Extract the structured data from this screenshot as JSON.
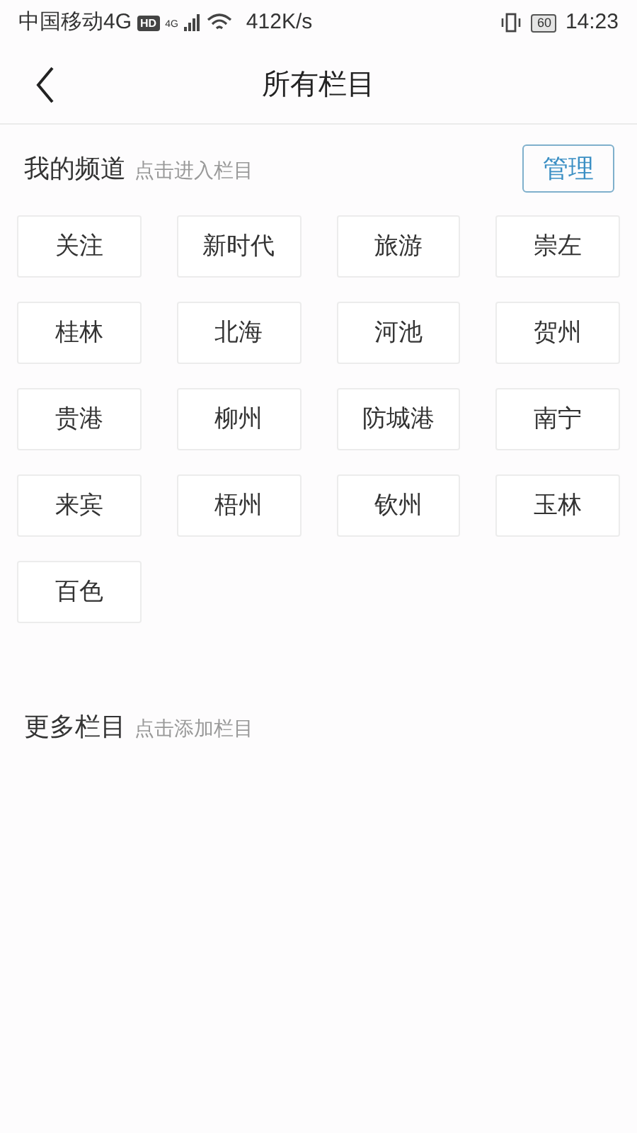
{
  "status_bar": {
    "carrier": "中国移动4G",
    "hd_badge": "HD",
    "network": "4G",
    "speed": "412K/s",
    "battery": "60",
    "time": "14:23"
  },
  "header": {
    "title": "所有栏目"
  },
  "my_channels": {
    "title": "我的频道",
    "hint": "点击进入栏目",
    "manage_button": "管理",
    "items": [
      "关注",
      "新时代",
      "旅游",
      "崇左",
      "桂林",
      "北海",
      "河池",
      "贺州",
      "贵港",
      "柳州",
      "防城港",
      "南宁",
      "来宾",
      "梧州",
      "钦州",
      "玉林",
      "百色"
    ]
  },
  "more_channels": {
    "title": "更多栏目",
    "hint": "点击添加栏目"
  }
}
